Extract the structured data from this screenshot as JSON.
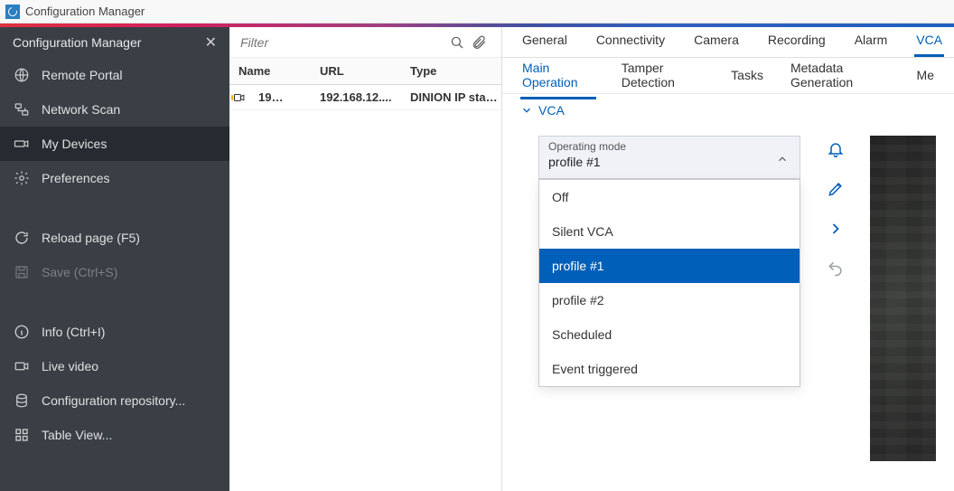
{
  "window": {
    "title": "Configuration Manager"
  },
  "sidebar": {
    "title": "Configuration Manager",
    "items": [
      {
        "id": "remote-portal",
        "label": "Remote Portal"
      },
      {
        "id": "network-scan",
        "label": "Network Scan"
      },
      {
        "id": "my-devices",
        "label": "My Devices",
        "selected": true
      },
      {
        "id": "preferences",
        "label": "Preferences"
      }
    ],
    "actions": [
      {
        "id": "reload",
        "label": "Reload page (F5)"
      },
      {
        "id": "save",
        "label": "Save (Ctrl+S)",
        "disabled": true
      }
    ],
    "tools": [
      {
        "id": "info",
        "label": "Info (Ctrl+I)"
      },
      {
        "id": "live",
        "label": "Live video"
      },
      {
        "id": "repo",
        "label": "Configuration repository..."
      },
      {
        "id": "table",
        "label": "Table View..."
      }
    ]
  },
  "devices": {
    "filter_placeholder": "Filter",
    "columns": {
      "name": "Name",
      "url": "URL",
      "type": "Type"
    },
    "rows": [
      {
        "name": "19…",
        "url": "192.168.12....",
        "type": "DINION IP starlight"
      }
    ]
  },
  "tabs_primary": {
    "items": [
      "General",
      "Connectivity",
      "Camera",
      "Recording",
      "Alarm",
      "VCA"
    ],
    "active": "VCA"
  },
  "tabs_secondary": {
    "items": [
      "Main Operation",
      "Tamper Detection",
      "Tasks",
      "Metadata Generation",
      "Me"
    ],
    "active": "Main Operation"
  },
  "section": {
    "vca_label": "VCA"
  },
  "operating_mode": {
    "label": "Operating mode",
    "value": "profile #1",
    "options": [
      "Off",
      "Silent VCA",
      "profile #1",
      "profile #2",
      "Scheduled",
      "Event triggered"
    ],
    "selected": "profile #1"
  }
}
